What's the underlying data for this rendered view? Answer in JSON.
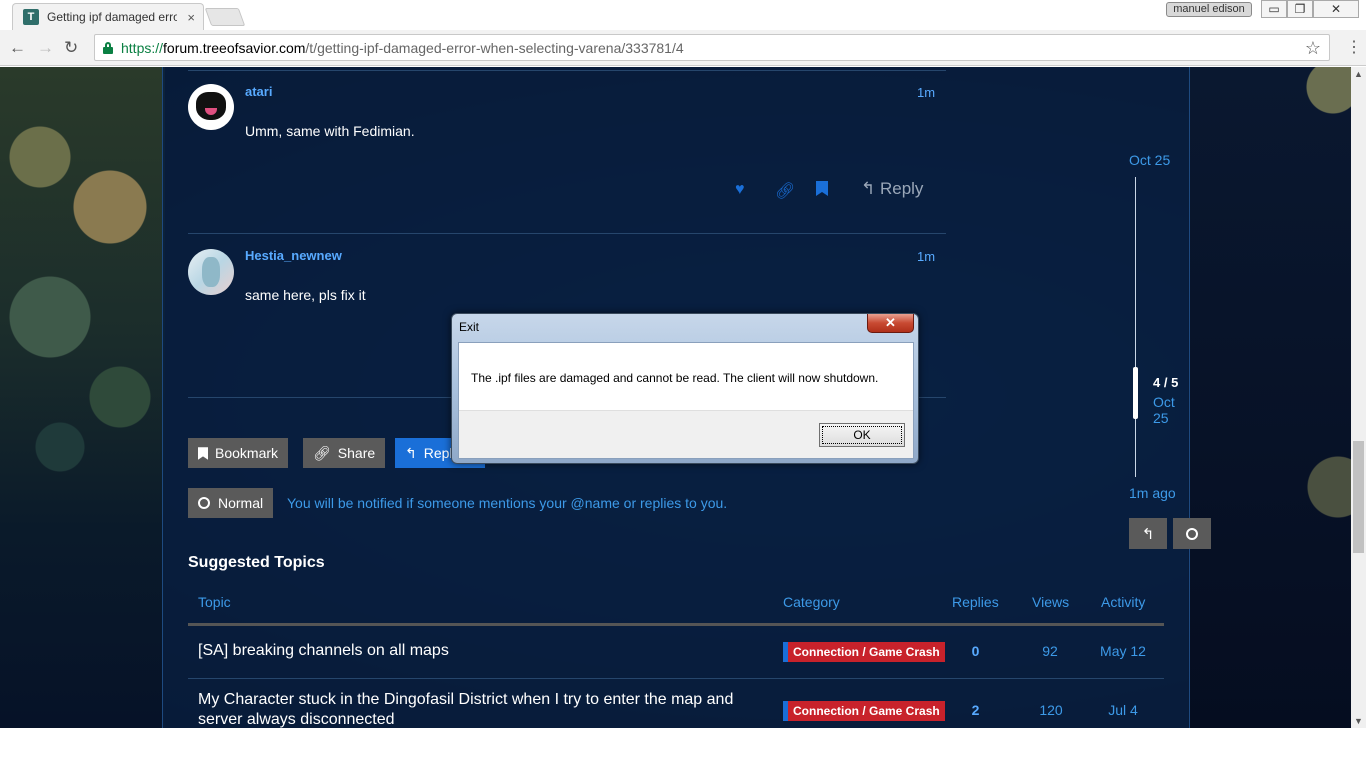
{
  "browser": {
    "tab_title": "Getting ipf damaged error when selecting varena",
    "tab_close": "×",
    "profile_name": "manuel edison",
    "url_scheme": "https://",
    "url_host": "forum.treeofsavior.com",
    "url_path": "/t/getting-ipf-damaged-error-when-selecting-varena/333781/4",
    "win_min": "▭",
    "win_max": "❐",
    "win_close": "✕"
  },
  "posts": [
    {
      "username": "atari",
      "time": "1m",
      "body": "Umm, same with Fedimian."
    },
    {
      "username": "Hestia_newnew",
      "time": "1m",
      "body": "same here, pls fix it"
    }
  ],
  "post_actions": {
    "reply_label": "Reply"
  },
  "footer_buttons": {
    "bookmark": "Bookmark",
    "share": "Share",
    "reply": "Reply",
    "notification_level": "Normal",
    "notification_text": "You will be notified if someone mentions your @name or replies to you."
  },
  "suggested": {
    "title": "Suggested Topics",
    "columns": {
      "topic": "Topic",
      "category": "Category",
      "replies": "Replies",
      "views": "Views",
      "activity": "Activity"
    },
    "rows": [
      {
        "title": "[SA] breaking channels on all maps",
        "category": "Connection / Game Crash",
        "replies": "0",
        "views": "92",
        "activity": "May 12"
      },
      {
        "title": "My Character stuck in the Dingofasil District when I try to enter the map and server always disconnected",
        "category": "Connection / Game Crash",
        "replies": "2",
        "views": "120",
        "activity": "Jul 4"
      }
    ]
  },
  "timeline": {
    "start_date": "Oct 25",
    "position": "4 / 5",
    "current_date": "Oct 25",
    "last_activity": "1m ago"
  },
  "dialog": {
    "title": "Exit",
    "message": "The .ipf files are damaged and cannot be read. The client will now shutdown.",
    "ok_label": "OK",
    "close_label": "✕"
  },
  "colors": {
    "accent_blue": "#1a6fd8",
    "link_blue": "#3d9ae8",
    "category_red": "#c8222b"
  }
}
